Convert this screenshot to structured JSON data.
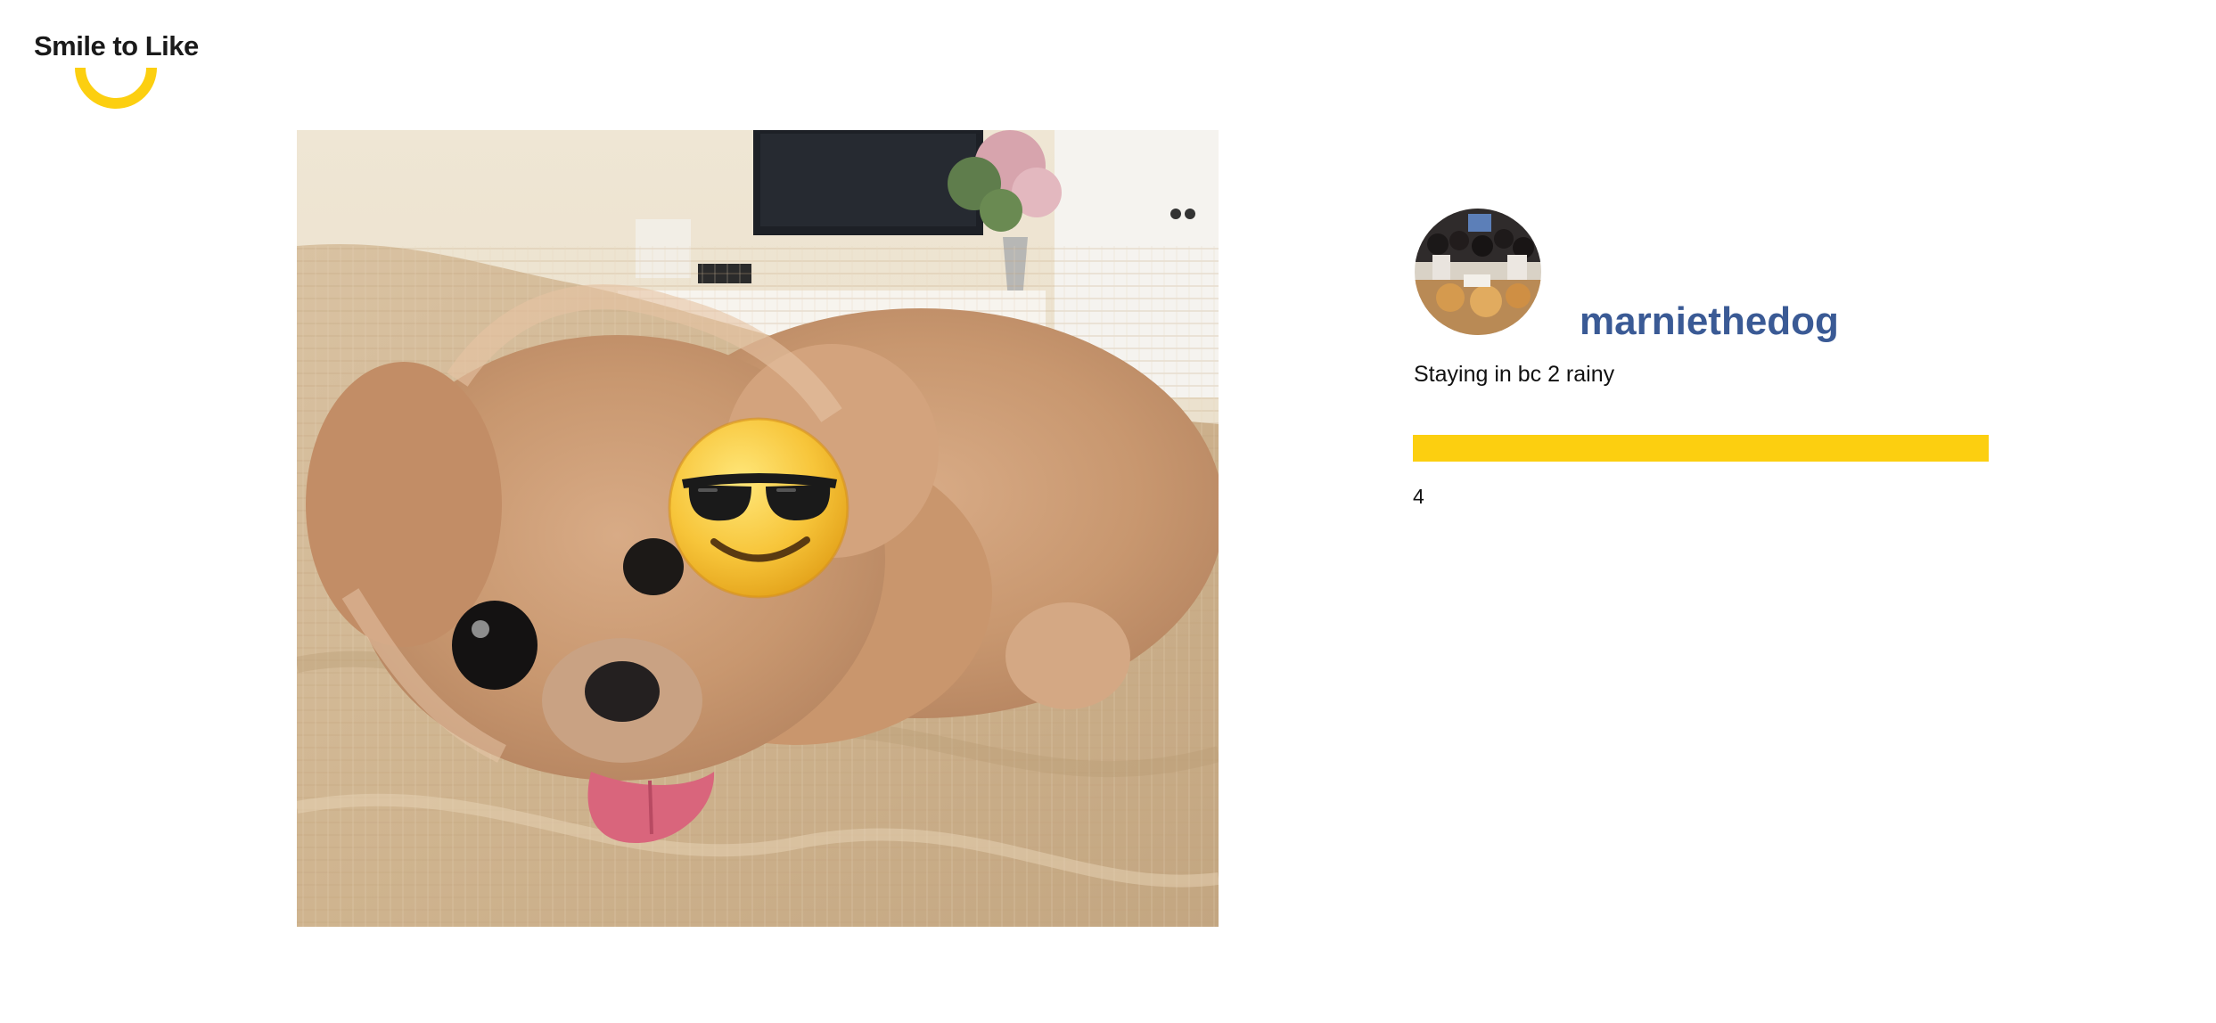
{
  "app": {
    "logo_text": "Smile to Like",
    "accent_color": "#fccf10"
  },
  "post": {
    "image_alt": "dog photo",
    "overlay_icon": "sunglasses-emoji-icon",
    "user": {
      "username": "marniethedog",
      "username_color": "#3a5a95"
    },
    "caption": "Staying in bc 2 rainy",
    "smile_progress": 1.0,
    "like_count": "4"
  }
}
